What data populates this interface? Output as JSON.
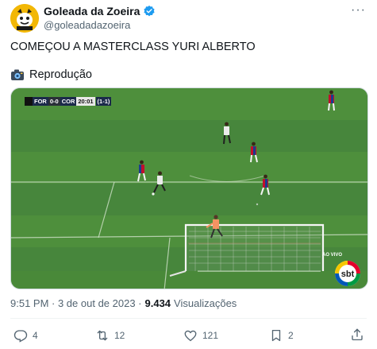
{
  "account": {
    "display_name": "Goleada da Zoeira",
    "handle": "@goleadadazoeira",
    "verified_color": "#1d9bf0",
    "avatar_color": "#f2b705"
  },
  "tweet": {
    "text": "COMEÇOU A MASTERCLASS YURI ALBERTO",
    "credit": "Reprodução",
    "timestamp": "9:51 PM · 3 de out de 2023 ·",
    "views_count": "9.434",
    "views_label": "Visualizações"
  },
  "broadcast": {
    "home_team": "FOR",
    "score": "0-0",
    "away_team": "COR",
    "clock": "20:01",
    "aggregate": "(1-1)",
    "live_label": "AO VIVO",
    "channel_logo": "sbt"
  },
  "actions": {
    "replies": "4",
    "retweets": "12",
    "likes": "121",
    "bookmarks": "2"
  }
}
